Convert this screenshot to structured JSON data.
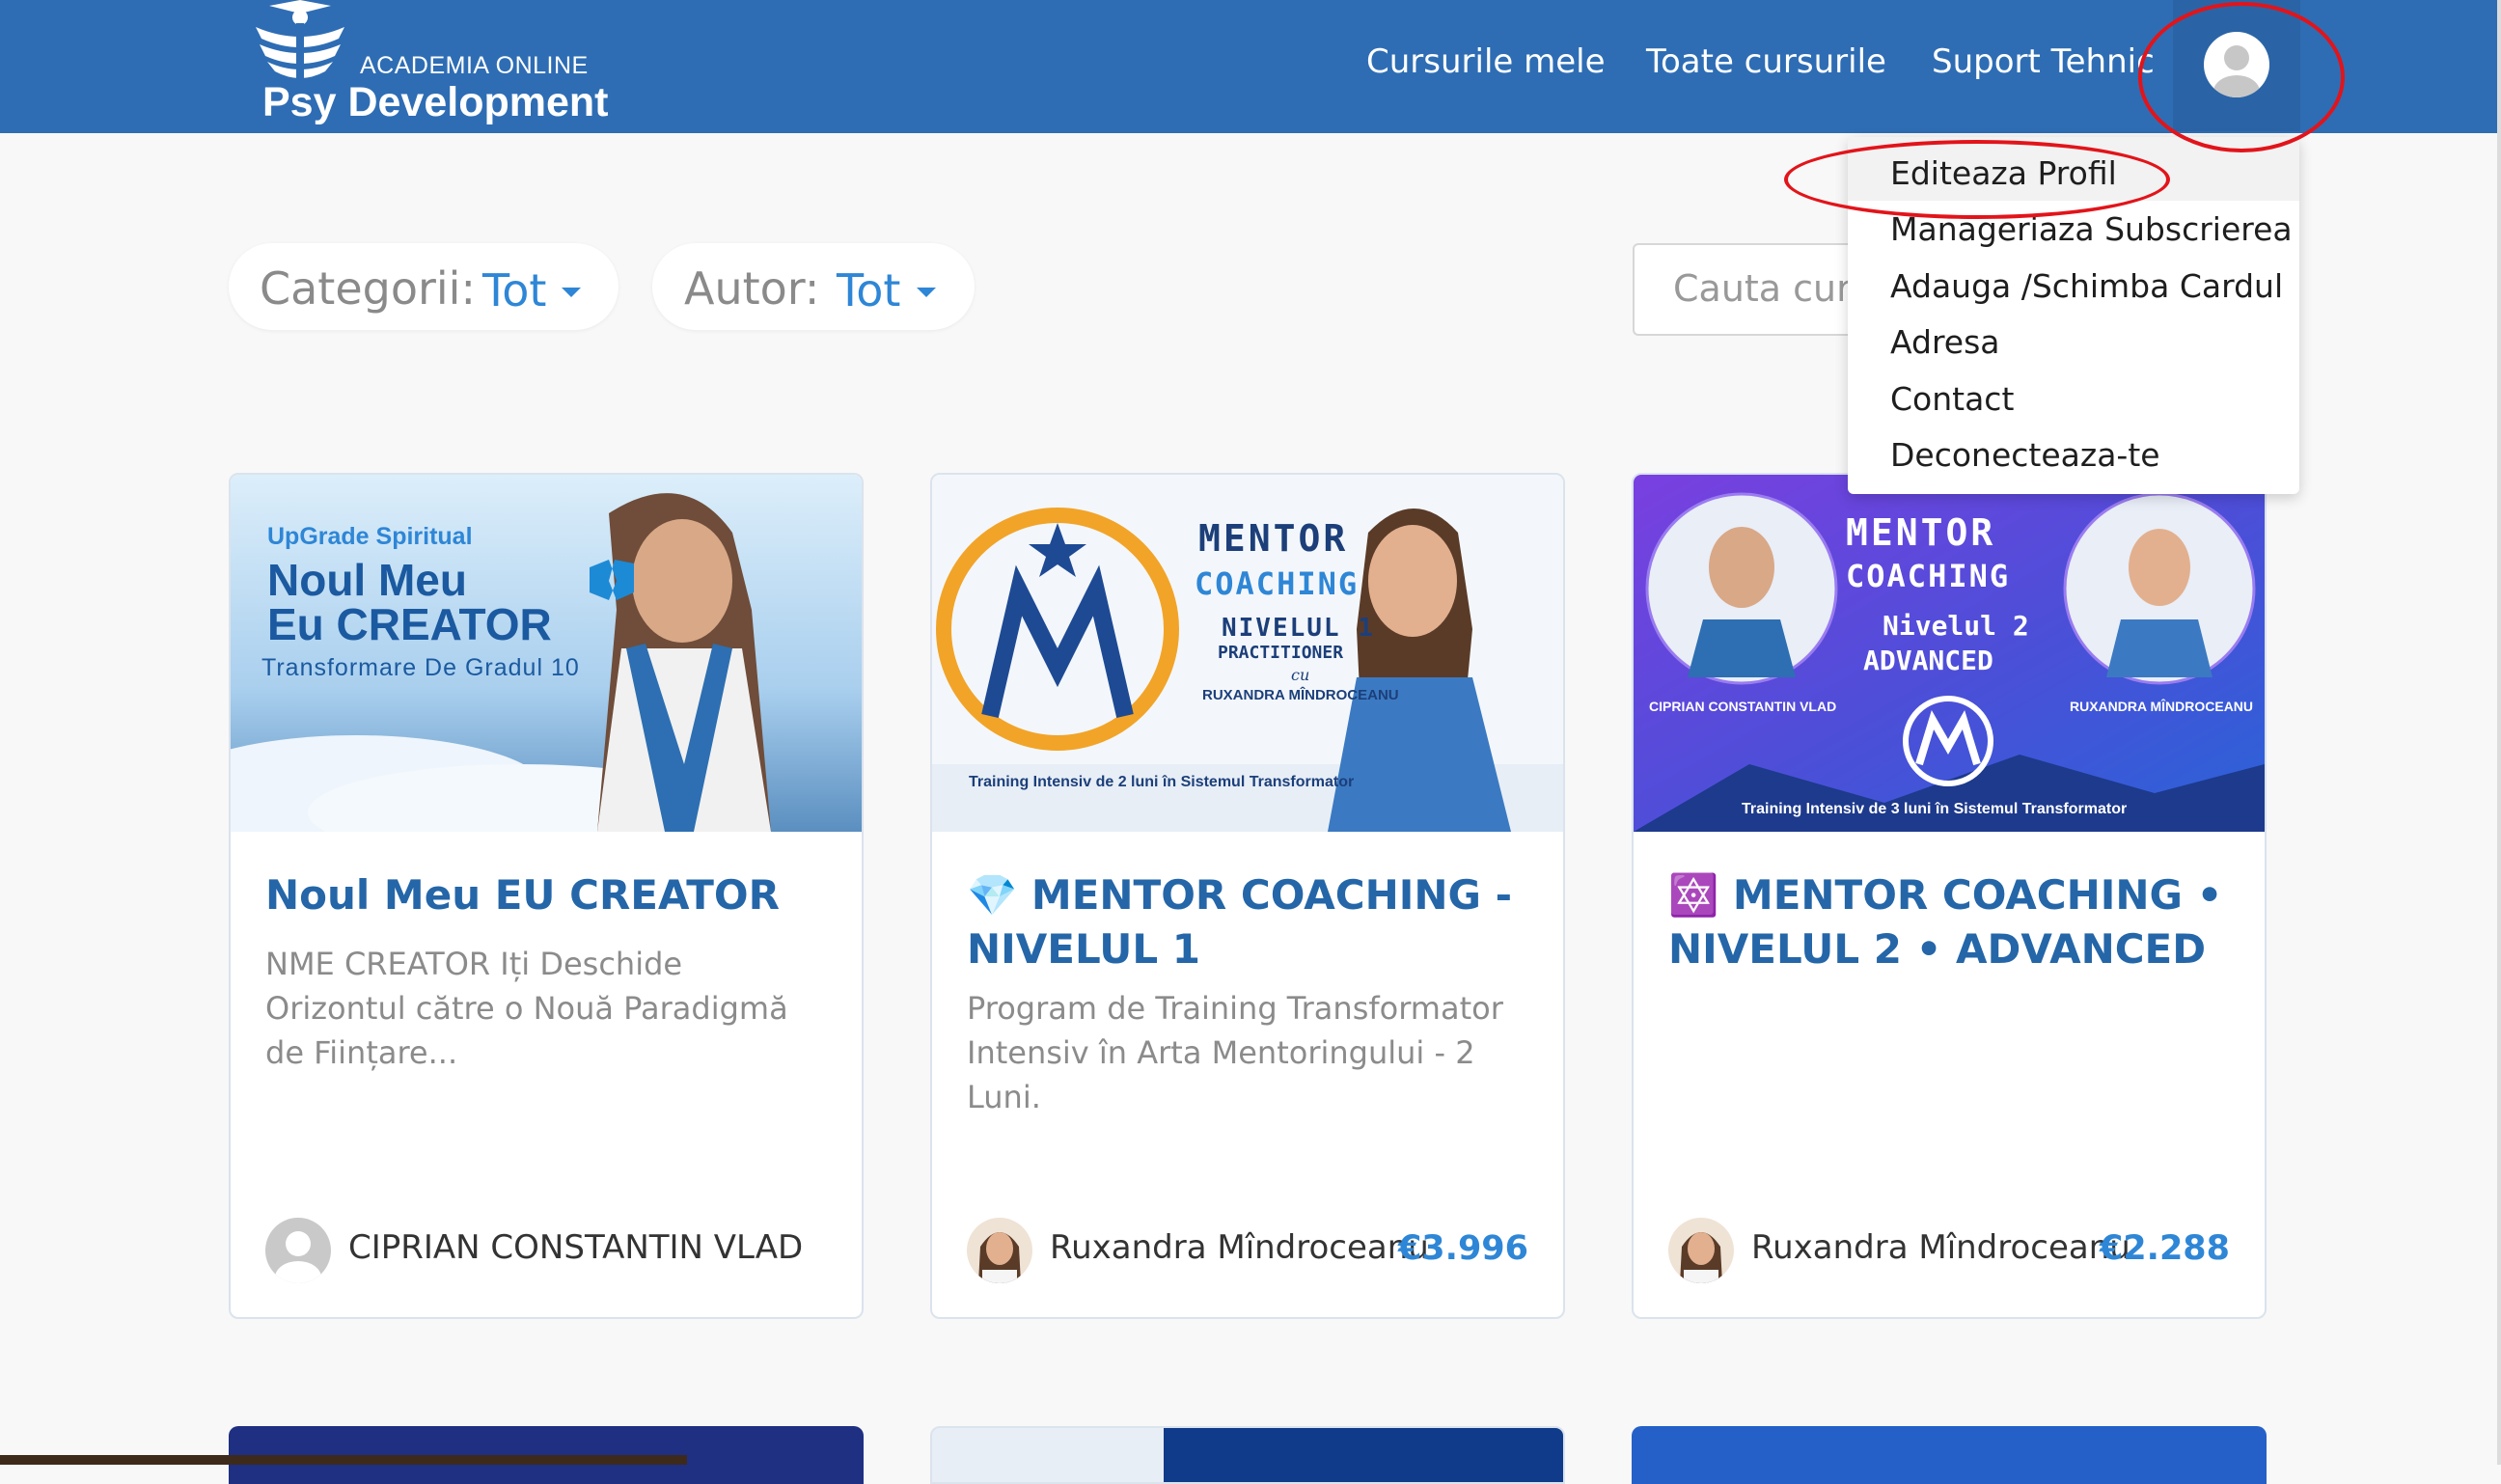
{
  "header": {
    "logo_small": "ACADEMIA ONLINE",
    "logo_big": "Psy Development",
    "nav": [
      "Cursurile mele",
      "Toate cursurile",
      "Suport Tehnic"
    ],
    "avatar_icon": "user-avatar-icon",
    "bg_color": "#2e6db4"
  },
  "filters": {
    "category_label": "Categorii:",
    "category_value": "Tot",
    "author_label": "Autor:",
    "author_value": "Tot",
    "search_placeholder": "Cauta curs"
  },
  "dropdown": {
    "items": [
      "Editeaza Profil",
      "Manageriaza Subscrierea",
      "Adauga /Schimba Cardul",
      "Adresa",
      "Contact",
      "Deconecteaza-te"
    ]
  },
  "cards": [
    {
      "banner": {
        "tag": "UpGrade Spiritual",
        "line1": "Noul Meu",
        "line2": "Eu CREATOR",
        "line3": "Transformare De Gradul 10"
      },
      "title": "Noul Meu EU CREATOR",
      "description": "NME CREATOR Iți Deschide Orizontul către o Nouă Paradigmă de Ființare...",
      "author": "CIPRIAN CONSTANTIN VLAD",
      "price": ""
    },
    {
      "banner": {
        "line1": "MENTOR",
        "line2": "COACHING",
        "line3": "NIVELUL 1",
        "line4": "PRACTITIONER",
        "line5": "cu",
        "line6": "RUXANDRA MÎNDROCEANU",
        "footer": "Training Intensiv de 2 luni în Sistemul Transformator"
      },
      "title": "💎 MENTOR COACHING - NIVELUL 1",
      "description": "Program de Training Transformator Intensiv în Arta Mentoringului - 2 Luni.",
      "author": "Ruxandra Mîndroceanu",
      "price": "€3.996"
    },
    {
      "banner": {
        "line1": "MENTOR",
        "line2": "COACHING",
        "line3": "Nivelul 2",
        "line4": "ADVANCED",
        "name_left": "CIPRIAN CONSTANTIN VLAD",
        "name_right": "RUXANDRA MÎNDROCEANU",
        "footer": "Training Intensiv de 3 luni în Sistemul Transformator"
      },
      "title": "🔯 MENTOR COACHING • NIVELUL 2 • ADVANCED",
      "description": "",
      "author": "Ruxandra Mîndroceanu",
      "price": "€2.288"
    }
  ]
}
